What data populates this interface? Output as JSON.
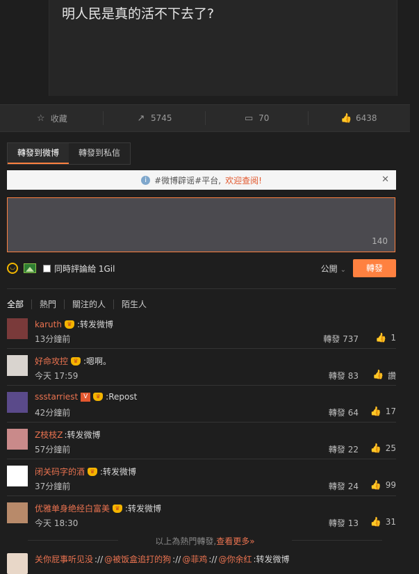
{
  "post": {
    "text": "明人民是真的活不下去了?"
  },
  "actions": [
    {
      "icon": "star-icon",
      "glyph": "☆",
      "label": "收藏"
    },
    {
      "icon": "share-icon",
      "glyph": "↗",
      "label": "5745"
    },
    {
      "icon": "comment-icon",
      "glyph": "▭",
      "label": "70"
    },
    {
      "icon": "like-icon",
      "glyph": "👍",
      "label": "6438"
    }
  ],
  "tabs": [
    {
      "label": "轉發到微博",
      "active": true
    },
    {
      "label": "轉發到私信",
      "active": false
    }
  ],
  "notice": {
    "prefix": "#微博辟谣#平台,",
    "highlight": "欢迎查阅!"
  },
  "composer": {
    "counter": "140"
  },
  "tools": {
    "checkbox_label": "同時評論給 1Gil",
    "visibility": "公開",
    "send_label": "轉發"
  },
  "filters": [
    "全部",
    "熱門",
    "關注的人",
    "陌生人"
  ],
  "reposts": [
    {
      "user": "karuth",
      "crown": true,
      "vip": false,
      "text": ":转发微博",
      "time": "13分鐘前",
      "repost": "轉發 737",
      "likes": "1",
      "avatar_color": "#7a3a3a"
    },
    {
      "user": "好命攻控",
      "crown": true,
      "vip": false,
      "text": ":嗯啊。",
      "time": "今天 17:59",
      "repost": "轉發 83",
      "likes": "讚",
      "avatar_color": "#d9d4cf"
    },
    {
      "user": "ssstarriest",
      "crown": true,
      "vip": true,
      "text": ":Repost",
      "time": "42分鐘前",
      "repost": "轉發 64",
      "likes": "17",
      "avatar_color": "#5a4a8a"
    },
    {
      "user": "Z枝枝Z",
      "crown": false,
      "vip": false,
      "text": ":转发微博",
      "time": "57分鐘前",
      "repost": "轉發 22",
      "likes": "25",
      "avatar_color": "#c98a8a"
    },
    {
      "user": "闭关码字的酒",
      "crown": true,
      "vip": false,
      "text": ":转发微博",
      "time": "37分鐘前",
      "repost": "轉發 24",
      "likes": "99",
      "avatar_color": "#ffffff"
    },
    {
      "user": "优雅单身绝经白富美",
      "crown": true,
      "vip": false,
      "text": ":转发微博",
      "time": "今天 18:30",
      "repost": "轉發 13",
      "likes": "31",
      "avatar_color": "#b88a6a"
    }
  ],
  "hot_note": {
    "text": "以上為熱門轉發,",
    "more": "查看更多»"
  },
  "last_repost": {
    "user": "关你屁事听见没",
    "chain": [
      ":// ",
      "@被饭盒追打的狗",
      "://",
      "@菲鸡",
      "://",
      "@你余红"
    ],
    "text": ":转发微博"
  }
}
